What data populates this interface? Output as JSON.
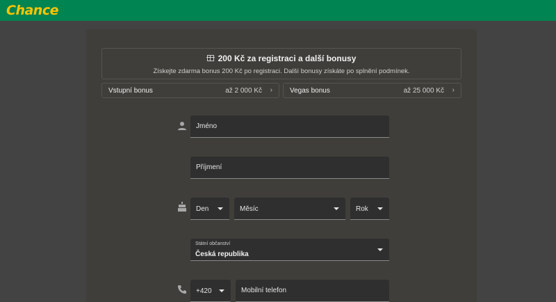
{
  "brand": {
    "logo_text": "Chance",
    "colors": {
      "header": "#008451",
      "logo": "#ffc400",
      "background": "#434343",
      "panel": "#3f3e3a"
    }
  },
  "bonus": {
    "icon": "gift-icon",
    "title": "200 Kč za registraci a další bonusy",
    "subtitle": "Získejte zdarma bonus 200 Kč po registraci. Další bonusy získáte po splnění podmínek.",
    "tiles": [
      {
        "name": "Vstupní bonus",
        "amount": "až 2 000 Kč"
      },
      {
        "name": "Vegas bonus",
        "amount": "až 25 000 Kč"
      }
    ]
  },
  "form": {
    "first_name": {
      "placeholder": "Jméno",
      "icon": "person-icon"
    },
    "last_name": {
      "placeholder": "Příjmení"
    },
    "birth": {
      "icon": "cake-icon",
      "day": "Den",
      "month": "Měsíc",
      "year": "Rok"
    },
    "citizenship": {
      "label": "Státní občanství",
      "value": "Česká republika"
    },
    "phone": {
      "icon": "phone-icon",
      "prefix": "+420",
      "placeholder": "Mobilní telefon"
    }
  }
}
